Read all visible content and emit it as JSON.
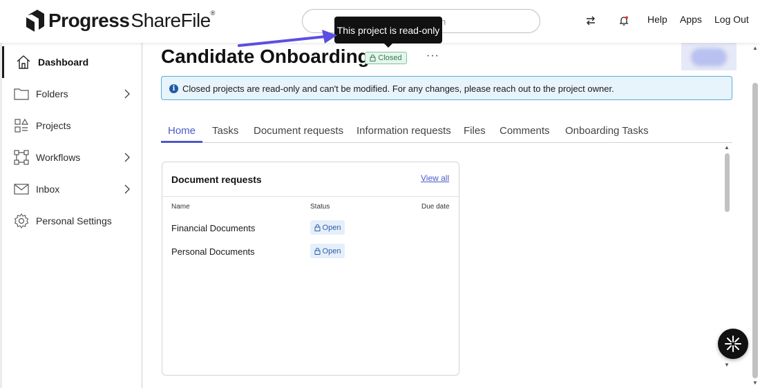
{
  "header": {
    "logo_progress": "Progress",
    "logo_sharefile": "ShareFile",
    "search_placeholder": "n",
    "links": {
      "help": "Help",
      "apps": "Apps",
      "logout": "Log Out"
    }
  },
  "tooltip": {
    "text": "This project is read-only"
  },
  "sidebar": {
    "items": [
      {
        "label": "Dashboard",
        "icon": "home-icon"
      },
      {
        "label": "Folders",
        "icon": "folder-icon"
      },
      {
        "label": "Projects",
        "icon": "projects-icon"
      },
      {
        "label": "Workflows",
        "icon": "workflows-icon"
      },
      {
        "label": "Inbox",
        "icon": "inbox-icon"
      },
      {
        "label": "Personal Settings",
        "icon": "gear-icon"
      }
    ]
  },
  "project": {
    "title": "Candidate Onboarding",
    "status": "Closed",
    "more": "···"
  },
  "banner": {
    "text": "Closed projects are read-only and can't be modified. For any changes, please reach out to the project owner."
  },
  "tabs": [
    "Home",
    "Tasks",
    "Document requests",
    "Information requests",
    "Files",
    "Comments",
    "Onboarding Tasks"
  ],
  "card": {
    "title": "Document requests",
    "view_all": "View all",
    "columns": {
      "name": "Name",
      "status": "Status",
      "due": "Due date"
    },
    "rows": [
      {
        "name": "Financial Documents",
        "status": "Open"
      },
      {
        "name": "Personal Documents",
        "status": "Open"
      }
    ]
  },
  "colors": {
    "accent": "#4b59c8",
    "closed_green": "#2e7d4f",
    "open_blue": "#2c5ea8",
    "banner_border": "#5aa9d6"
  }
}
